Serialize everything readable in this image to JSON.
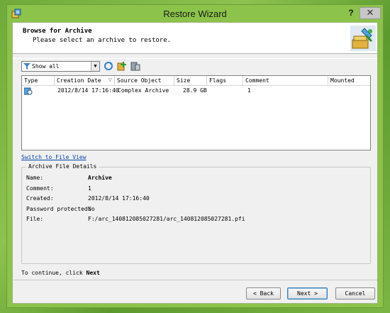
{
  "window": {
    "title": "Restore Wizard",
    "help_label": "?",
    "close_label": "✕"
  },
  "header": {
    "title": "Browse for Archive",
    "subtitle": "Please select an archive to restore."
  },
  "toolbar": {
    "filter_value": "Show all",
    "icons": [
      "refresh-icon",
      "add-archive-icon",
      "properties-icon"
    ]
  },
  "list": {
    "columns": [
      "Type",
      "Creation Date",
      "Source Object",
      "Size",
      "Flags",
      "Comment",
      "Mounted"
    ],
    "rows": [
      {
        "type_icon": "archive-icon",
        "creation_date": "2012/8/14 17:16:40",
        "source_object": "Complex Archive",
        "size": "28.9 GB",
        "flags": "",
        "comment": "1",
        "mounted": ""
      }
    ]
  },
  "switch_link": "Switch to File View",
  "details": {
    "legend": "Archive File Details",
    "fields": [
      {
        "label": "Name:",
        "value": "Archive"
      },
      {
        "label": "Comment:",
        "value": "1"
      },
      {
        "label": "Created:",
        "value": "2012/8/14 17:16:40"
      },
      {
        "label": "Password protected:",
        "value": "No"
      },
      {
        "label": "File:",
        "value": "F:/arc_140812085027281/arc_140812085027281.pfi"
      }
    ]
  },
  "footer": {
    "continue_prefix": "To continue, click ",
    "continue_action": "Next"
  },
  "buttons": {
    "back": "< Back",
    "next": "Next >",
    "cancel": "Cancel"
  },
  "colors": {
    "desktop": "#7bb544",
    "titlebar": "#8cc34a",
    "link": "#0645ad"
  }
}
